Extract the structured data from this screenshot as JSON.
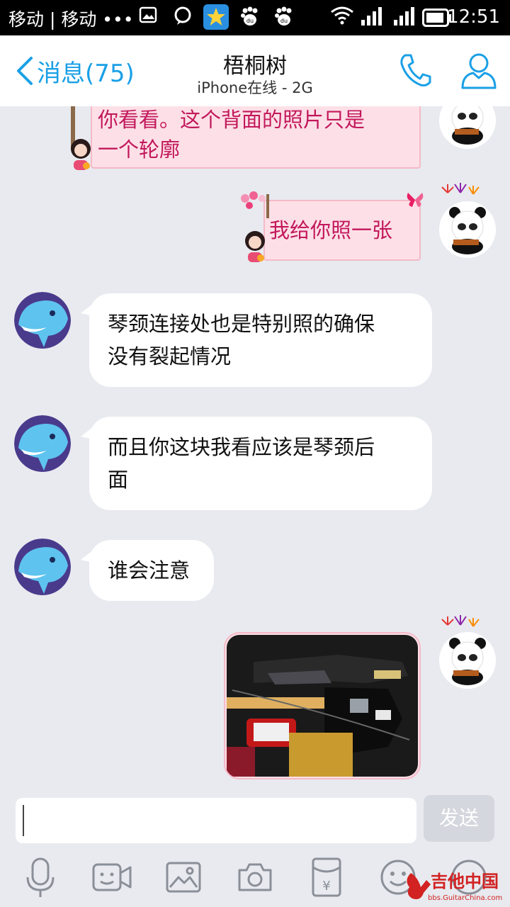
{
  "status_bar": {
    "carrier": "移动 | 移动 •••",
    "time": "12:51"
  },
  "header": {
    "back_label": "消息(75)",
    "contact_name": "梧桐树",
    "contact_status": "iPhone在线 - 2G"
  },
  "messages": [
    {
      "direction": "out",
      "text_line1": "你看看。这个背面的照片只是",
      "text_line2": "一个轮廓"
    },
    {
      "direction": "out",
      "text": "我给你照一张"
    },
    {
      "direction": "in",
      "text_line1": "琴颈连接处也是特别照的确保",
      "text_line2": "没有裂起情况"
    },
    {
      "direction": "in",
      "text_line1": "而且你这块我看应该是琴颈后",
      "text_line2": "面"
    },
    {
      "direction": "in",
      "text": "谁会注意"
    },
    {
      "direction": "out",
      "type": "image",
      "description_icon": "guitar-photo"
    }
  ],
  "input": {
    "value": "",
    "send_label": "发送"
  },
  "toolbar": {
    "icons": [
      "microphone-icon",
      "video-icon",
      "image-icon",
      "camera-icon",
      "red-packet-icon",
      "emoji-icon",
      "more-icon"
    ]
  },
  "watermark": {
    "main": "吉他中国",
    "sub": "bbs.GuitarChina.com"
  },
  "colors": {
    "accent": "#1aa0e6",
    "out_bubble": "#fde0e7",
    "out_text": "#c2185b",
    "background": "#e8eaef"
  }
}
